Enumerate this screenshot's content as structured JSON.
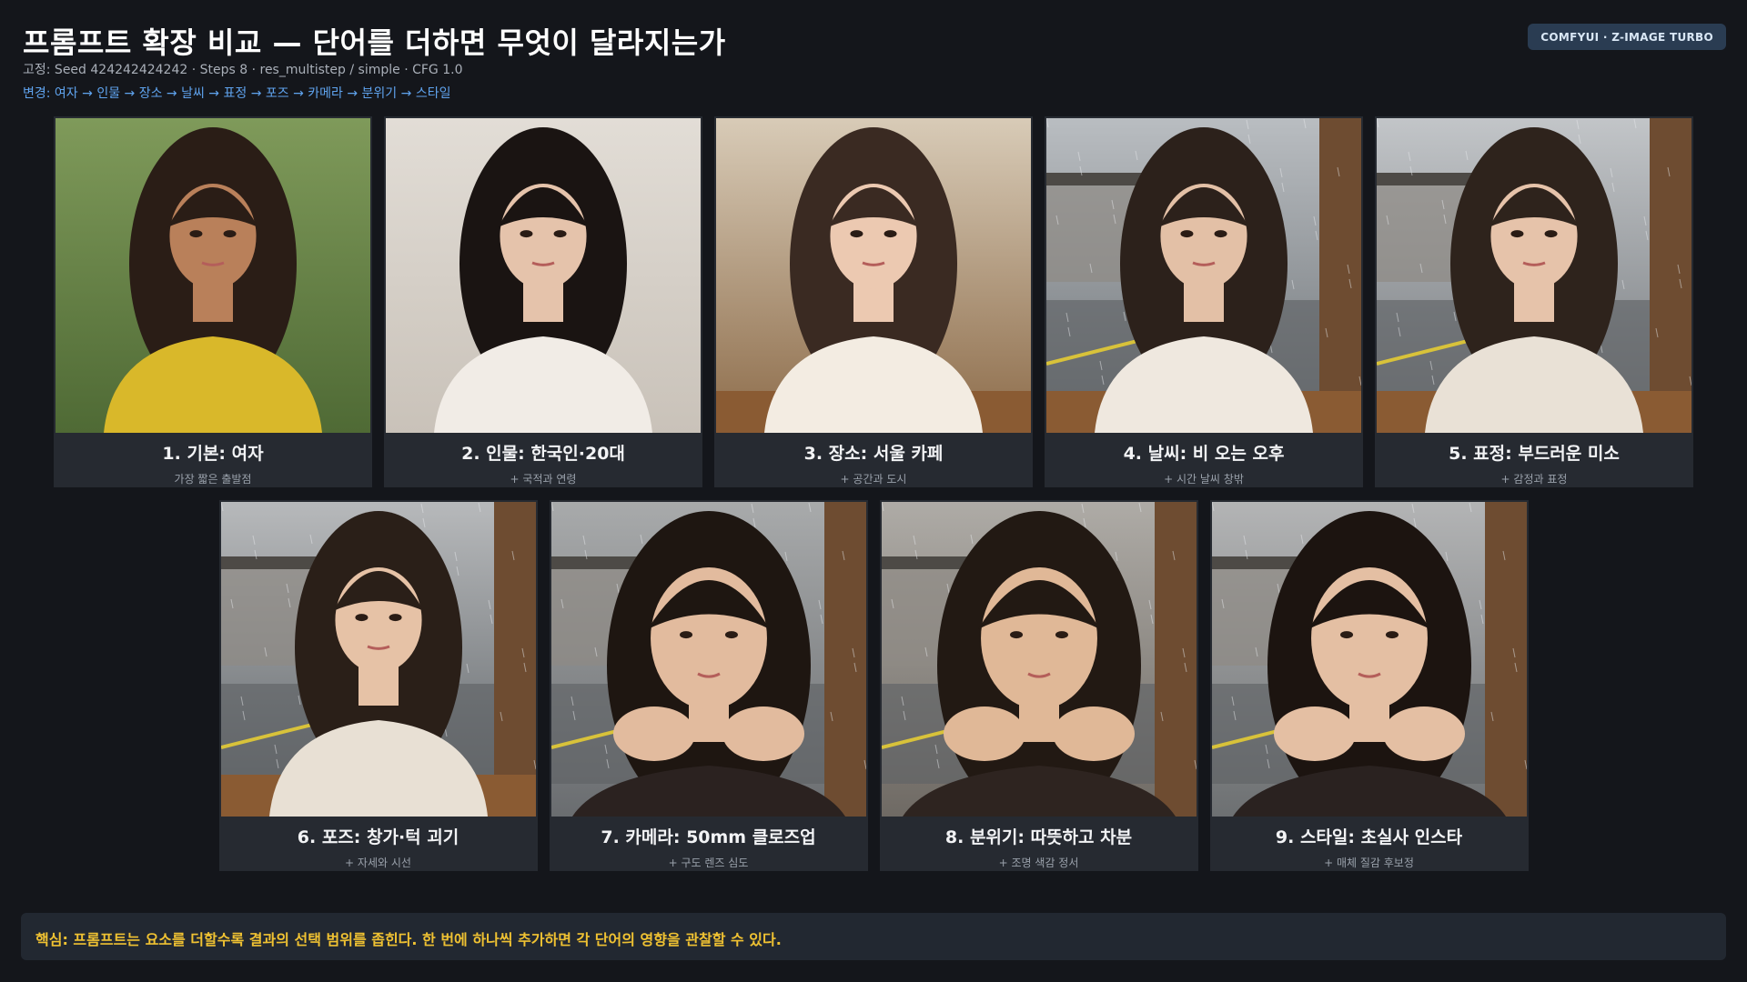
{
  "header": {
    "title": "프롬프트 확장 비교 — 단어를 더하면 무엇이 달라지는가",
    "subtitle": "고정: Seed 424242424242 · Steps 8 · res_multistep / simple · CFG 1.0",
    "sequence": "변경: 여자 → 인물 → 장소 → 날씨 → 표정 → 포즈 → 카메라 → 분위기 → 스타일",
    "badge": "COMFYUI · Z-IMAGE TURBO"
  },
  "colors": {
    "background": "#14161b",
    "card": "#262a31",
    "accent_blue": "#5fa3ee",
    "highlight": "#f0c232",
    "badge_bg": "#2a3c52"
  },
  "cards": [
    {
      "caption": "1. 기본: 여자",
      "sub": "가장 짧은 출발점",
      "scene": "portrait-grass"
    },
    {
      "caption": "2. 인물: 한국인·20대",
      "sub": "+ 국적과 연령",
      "scene": "portrait-studio"
    },
    {
      "caption": "3. 장소: 서울 카페",
      "sub": "+ 공간과 도시",
      "scene": "cafe-interior"
    },
    {
      "caption": "4. 날씨: 비 오는 오후",
      "sub": "+ 시간 날씨 창밖",
      "scene": "cafe-window-rain"
    },
    {
      "caption": "5. 표정: 부드러운 미소",
      "sub": "+ 감정과 표정",
      "scene": "cafe-window-smile"
    },
    {
      "caption": "6. 포즈: 창가·턱 괴기",
      "sub": "+ 자세와 시선",
      "scene": "window-chin-rest"
    },
    {
      "caption": "7. 카메라: 50mm 클로즈업",
      "sub": "+ 구도 렌즈 심도",
      "scene": "closeup-50mm"
    },
    {
      "caption": "8. 분위기: 따뜻하고 차분",
      "sub": "+ 조명 색감 정서",
      "scene": "closeup-warm"
    },
    {
      "caption": "9. 스타일: 초실사 인스타",
      "sub": "+ 매체 질감 후보정",
      "scene": "closeup-instagram"
    }
  ],
  "footer": {
    "text": "핵심: 프롬프트는 요소를 더할수록 결과의 선택 범위를 좁힌다. 한 번에 하나씩 추가하면 각 단어의 영향을 관찰할 수 있다."
  }
}
